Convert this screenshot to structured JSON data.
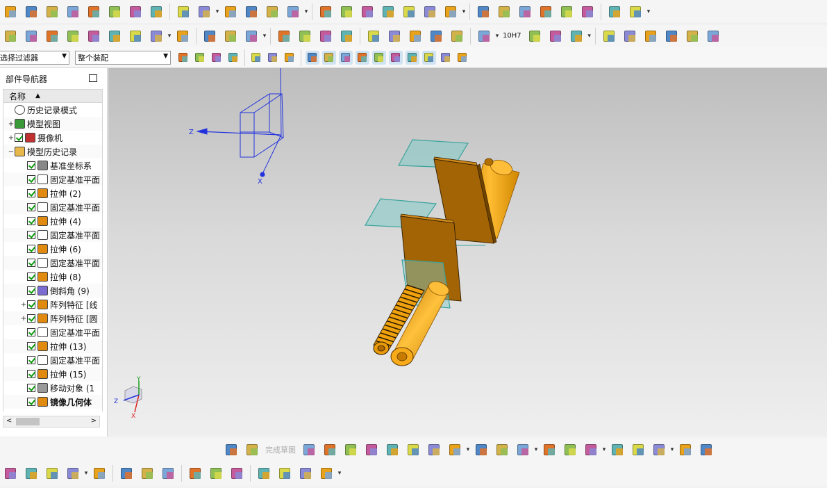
{
  "toolbar": {
    "row1_icons": [
      "boolean-unite-icon",
      "extrude-icon",
      "block-icon",
      "cylinder-icon",
      "revolve-icon",
      "sweep-icon",
      "trim-body-icon",
      "pattern-icon",
      "hole-icon",
      "boss-icon",
      "offset-face-icon",
      "thicken-icon",
      "chamfer-icon",
      "edge-blend-icon",
      "shell-icon",
      "draft-icon",
      "mirror-icon",
      "sew-icon",
      "split-body-icon",
      "tube-icon",
      "ruled-surface-icon",
      "through-curves-icon",
      "through-mesh-icon",
      "n-sided-icon",
      "swoop-icon",
      "law-extension-icon",
      "section-icon",
      "move-face-icon",
      "replace-face-icon"
    ],
    "row2_icons": [
      "sketch-icon",
      "layer-settings-icon",
      "wave-linker-icon",
      "assembly-icon",
      "add-component-icon",
      "mate-icon",
      "component-pattern-icon",
      "rename-icon",
      "spline-icon",
      "studio-surface-icon",
      "thread-icon",
      "spring-icon",
      "gear-icon",
      "bolt-icon",
      "measure-distance-icon",
      "shaded-icon",
      "triangle-icon",
      "table-icon",
      "datum-plane-icon",
      "view-icon",
      "smart-point-icon",
      "dimension-icon",
      "tolerance-icon",
      "section-view-icon",
      "library-icon",
      "line-icon",
      "arc-icon",
      "studio-spline-icon",
      "fillet-curve-icon",
      "offset-curve-icon",
      "project-curve-icon"
    ],
    "tolerance_label": "10H7",
    "selection_filter": "选择过滤器",
    "assembly_scope": "整个装配",
    "row3_icons": [
      "filter-icon",
      "snap-icon",
      "point-icon",
      "curve-icon",
      "select-box-icon",
      "face-icon",
      "body-icon",
      "end-point-icon",
      "mid-point-icon",
      "control-point-icon",
      "intersection-icon",
      "center-point-icon",
      "quadrant-icon",
      "existing-point-icon",
      "point-on-curve-icon",
      "tangent-point-icon",
      "grid-icon"
    ]
  },
  "navigator": {
    "title": "部件导航器",
    "column_name": "名称",
    "items": [
      {
        "label": "历史记录模式",
        "icon": "clock-icon",
        "level": 0,
        "expand": "",
        "checked": false
      },
      {
        "label": "模型视图",
        "icon": "model-view-icon",
        "level": 0,
        "expand": "+",
        "checked": false
      },
      {
        "label": "摄像机",
        "icon": "camera-icon",
        "level": 0,
        "expand": "+",
        "checked": true
      },
      {
        "label": "模型历史记录",
        "icon": "folder-icon",
        "level": 0,
        "expand": "−",
        "checked": false
      },
      {
        "label": "基准坐标系",
        "icon": "datum-csys-icon",
        "level": 1,
        "expand": "",
        "checked": true
      },
      {
        "label": "固定基准平面",
        "icon": "datum-plane-icon",
        "level": 1,
        "expand": "",
        "checked": true
      },
      {
        "label": "拉伸 (2)",
        "icon": "extrude-icon",
        "level": 1,
        "expand": "",
        "checked": true
      },
      {
        "label": "固定基准平面",
        "icon": "datum-plane-icon",
        "level": 1,
        "expand": "",
        "checked": true
      },
      {
        "label": "拉伸 (4)",
        "icon": "extrude-icon",
        "level": 1,
        "expand": "",
        "checked": true
      },
      {
        "label": "固定基准平面",
        "icon": "datum-plane-icon",
        "level": 1,
        "expand": "",
        "checked": true
      },
      {
        "label": "拉伸 (6)",
        "icon": "extrude-icon",
        "level": 1,
        "expand": "",
        "checked": true
      },
      {
        "label": "固定基准平面",
        "icon": "datum-plane-icon",
        "level": 1,
        "expand": "",
        "checked": true
      },
      {
        "label": "拉伸 (8)",
        "icon": "extrude-icon",
        "level": 1,
        "expand": "",
        "checked": true
      },
      {
        "label": "倒斜角 (9)",
        "icon": "chamfer-icon",
        "level": 1,
        "expand": "",
        "checked": true
      },
      {
        "label": "阵列特征 [线",
        "icon": "pattern-icon",
        "level": 1,
        "expand": "+",
        "checked": true
      },
      {
        "label": "阵列特征 [圆",
        "icon": "pattern-icon",
        "level": 1,
        "expand": "+",
        "checked": true
      },
      {
        "label": "固定基准平面",
        "icon": "datum-plane-icon",
        "level": 1,
        "expand": "",
        "checked": true
      },
      {
        "label": "拉伸 (13)",
        "icon": "extrude-icon",
        "level": 1,
        "expand": "",
        "checked": true
      },
      {
        "label": "固定基准平面",
        "icon": "datum-plane-icon",
        "level": 1,
        "expand": "",
        "checked": true
      },
      {
        "label": "拉伸 (15)",
        "icon": "extrude-icon",
        "level": 1,
        "expand": "",
        "checked": true
      },
      {
        "label": "移动对象 (1",
        "icon": "move-object-icon",
        "level": 1,
        "expand": "",
        "checked": true
      },
      {
        "label": "镜像几何体",
        "icon": "mirror-geometry-icon",
        "level": 1,
        "expand": "",
        "checked": true,
        "bold": true
      }
    ]
  },
  "viewport": {
    "axis_labels": {
      "z": "Z",
      "x": "X",
      "y": "Y"
    }
  },
  "sketch_toolbar": {
    "finish_label": "完成草图",
    "icons": [
      "sketch-task-icon",
      "finish-sketch-icon",
      "profile-icon",
      "line-icon",
      "arc-icon",
      "circle-icon",
      "fillet-icon",
      "chamfer-icon",
      "rectangle-icon",
      "polygon-icon",
      "point-icon",
      "offset-icon",
      "quick-trim-icon",
      "quick-extend-icon",
      "make-corner-icon",
      "constraints-icon",
      "dimension-icon",
      "geometric-constraint-icon",
      "auto-constrain-icon",
      "display-constraints-icon",
      "convert-reference-icon"
    ]
  },
  "bottom_toolbar": {
    "icons": [
      "assembly-nav-icon",
      "component-icon",
      "add-component-icon",
      "new-component-icon",
      "mirror-assembly-icon",
      "exploded-view-icon",
      "constraint-icon",
      "wave-icon",
      "assembly-cut-icon",
      "move-component-icon",
      "check-clearance-icon",
      "sequence-icon",
      "link-icon",
      "route-icon",
      "reference-set-icon"
    ]
  },
  "colors": {
    "viewport_top": "#bdbdbd",
    "viewport_bottom": "#efefef",
    "plate": "#a36406",
    "plate_edge": "#3b2300",
    "cylinder": "#f5a60f",
    "datum_plane": "#7fcbc7",
    "csys": "#2233dd",
    "check": "#0a9a0a"
  }
}
